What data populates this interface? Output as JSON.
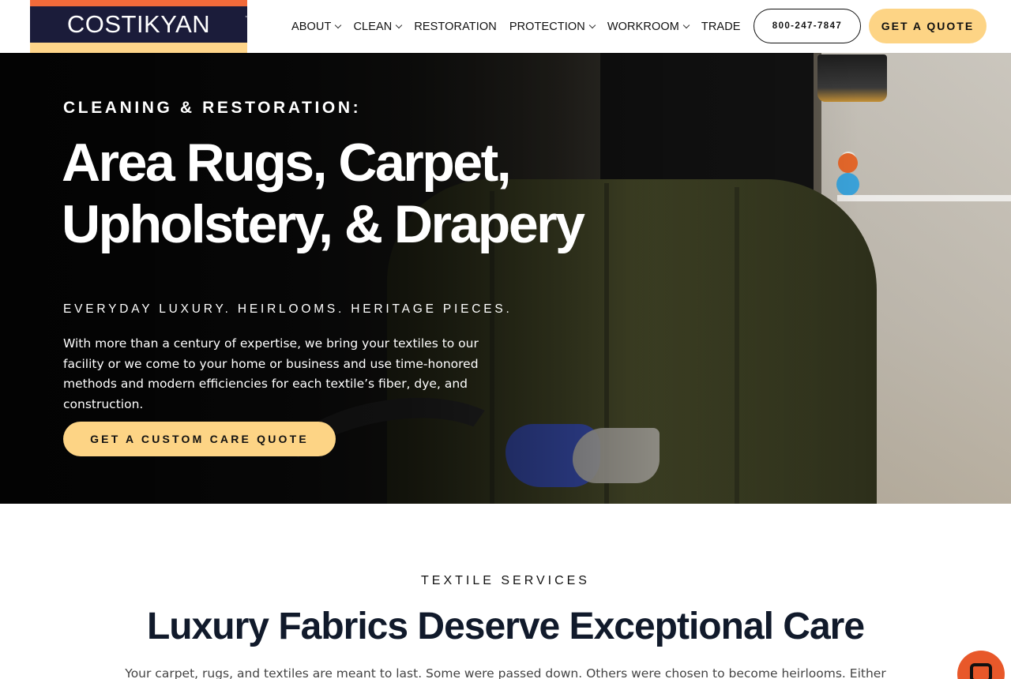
{
  "header": {
    "logo_text": "COSTIKYAN",
    "logo_tm": "™",
    "nav": [
      {
        "label": "ABOUT",
        "has_dropdown": true
      },
      {
        "label": "CLEAN",
        "has_dropdown": true
      },
      {
        "label": "RESTORATION",
        "has_dropdown": false
      },
      {
        "label": "PROTECTION",
        "has_dropdown": true
      },
      {
        "label": "WORKROOM",
        "has_dropdown": true
      },
      {
        "label": "TRADE",
        "has_dropdown": false
      }
    ],
    "phone": "800-247-7847",
    "quote_label": "GET A QUOTE"
  },
  "hero": {
    "kicker": "CLEANING & RESTORATION:",
    "title_line1": "Area Rugs, Carpet,",
    "title_line2": "Upholstery, & Drapery",
    "subtitle": "EVERYDAY LUXURY. HEIRLOOMS. HERITAGE PIECES.",
    "body": "With more than a century of expertise, we bring your textiles to our facility or we come to your home or business and use time-honored methods and modern efficiencies for each textile’s fiber, dye, and construction.",
    "cta_label": "GET A CUSTOM CARE QUOTE"
  },
  "services": {
    "kicker": "TEXTILE SERVICES",
    "title": "Luxury Fabrics Deserve Exceptional Care",
    "body": "Your carpet, rugs, and textiles are meant to last. Some were passed down. Others were chosen to become heirlooms. Either"
  },
  "colors": {
    "accent_yellow": "#fdd485",
    "logo_navy": "#1b1c3a",
    "logo_orange": "#f26a3a",
    "chat_orange": "#e8582a"
  },
  "icons": {
    "nav_dropdown": "chevron-down-icon",
    "chat": "chat-icon"
  }
}
